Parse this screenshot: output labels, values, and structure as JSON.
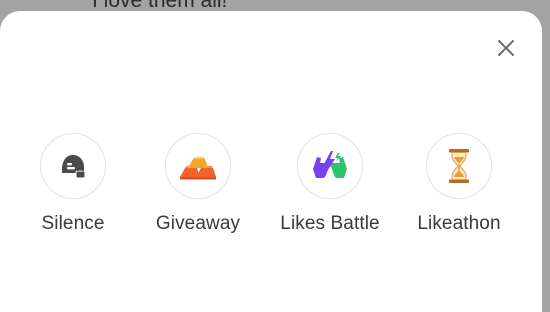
{
  "background": {
    "peek_text": "I love them all!"
  },
  "sheet": {
    "close_icon": "close-icon",
    "options": [
      {
        "label": "Silence",
        "icon": "silence-icon",
        "color": "#4a4a4a"
      },
      {
        "label": "Giveaway",
        "icon": "gold-bars-icon",
        "color": "#f5a623"
      },
      {
        "label": "Likes Battle",
        "icon": "likes-battle-icon",
        "color": "#7b3ff2"
      },
      {
        "label": "Likeathon",
        "icon": "hourglass-icon",
        "color": "#d9a441"
      }
    ]
  }
}
